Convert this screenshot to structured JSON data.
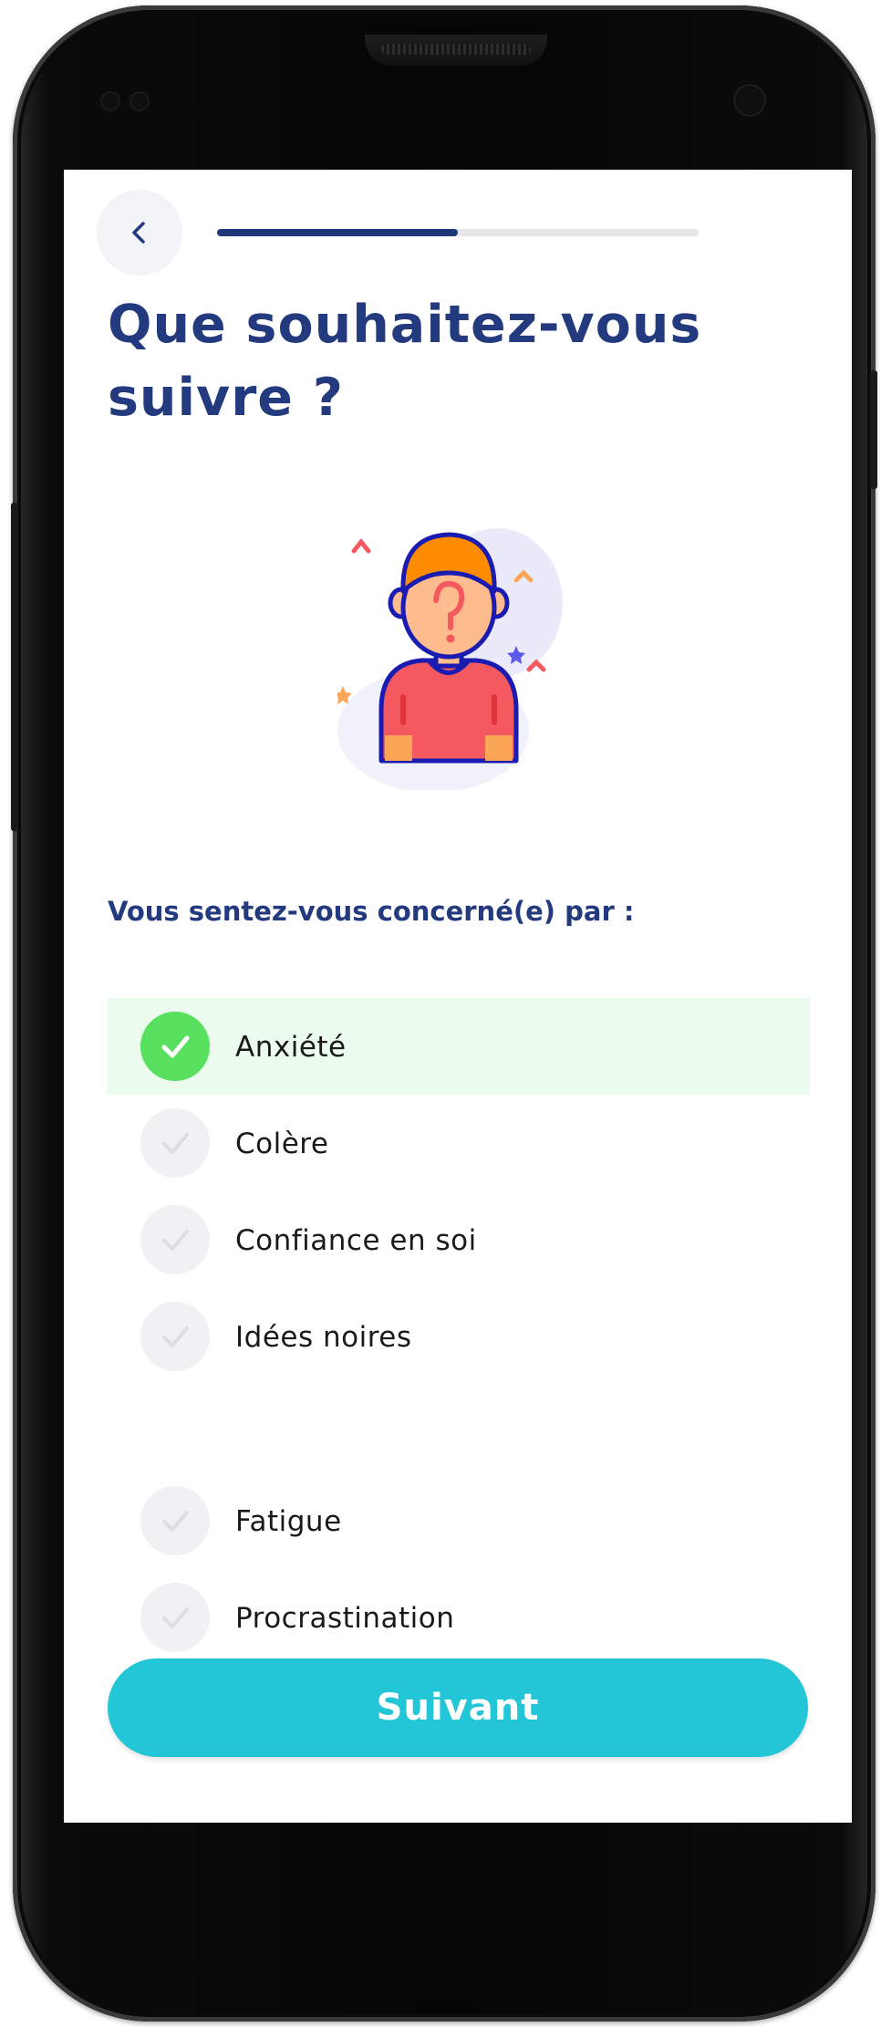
{
  "header": {
    "back_icon": "chevron-left-icon",
    "progress_fraction": 0.5
  },
  "main": {
    "title": "Que souhaitez-vous suivre ?",
    "illustration_icon": "question-person-illustration",
    "subtitle": "Vous sentez-vous concerné(e) par :",
    "options": [
      {
        "label": "Anxiété",
        "selected": true
      },
      {
        "label": "Colère",
        "selected": false
      },
      {
        "label": "Confiance en soi",
        "selected": false
      },
      {
        "label": "Idées noires",
        "selected": false
      },
      {
        "label": "Fatigue",
        "selected": false
      },
      {
        "label": "Procrastination",
        "selected": false
      }
    ]
  },
  "footer": {
    "next_label": "Suivant"
  },
  "colors": {
    "primary_navy": "#233a7f",
    "progress": "#1f3778",
    "button": "#22c6d6",
    "check_selected": "#58e05e",
    "row_selected": "#ebfbed"
  }
}
